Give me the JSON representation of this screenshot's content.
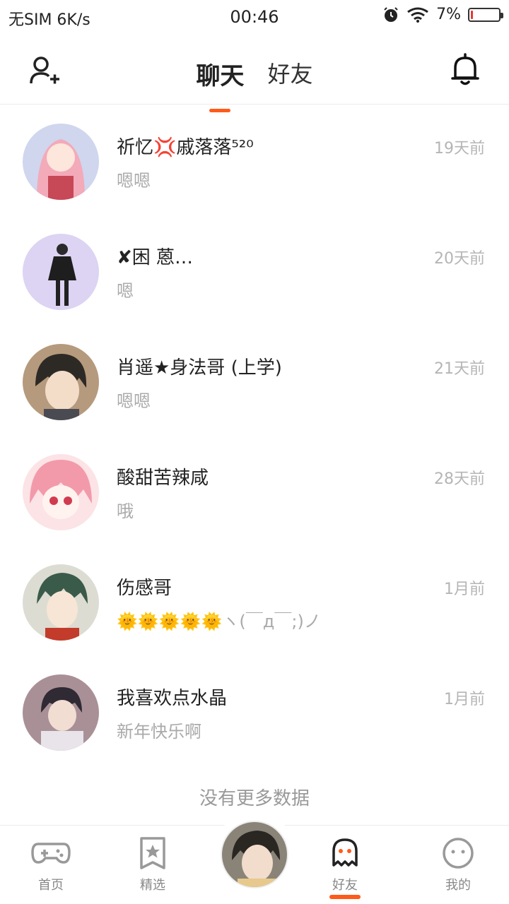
{
  "status_bar": {
    "left": "无SIM 6K/s",
    "time": "00:46",
    "battery": "7%",
    "battery_level": 0.07,
    "icons": [
      "alarm-icon",
      "wifi-icon",
      "battery-icon"
    ]
  },
  "header": {
    "tabs": [
      {
        "label": "聊天",
        "active": true
      },
      {
        "label": "好友",
        "active": false
      }
    ],
    "left_icon": "add-user-icon",
    "right_icon": "bell-icon",
    "accent": "#ff5a1a"
  },
  "chats": [
    {
      "name": "祈忆💢戚落落⁵²⁰",
      "message": "嗯嗯",
      "time": "19天前",
      "avatar_color": "#f4b7c4"
    },
    {
      "name": "✘困  蒽…",
      "message": "嗯",
      "time": "20天前",
      "avatar_color": "#d9cdee"
    },
    {
      "name": "肖遥★身法哥  (上学)",
      "message": "嗯嗯",
      "time": "21天前",
      "avatar_color": "#8a7a66"
    },
    {
      "name": "酸甜苦辣咸",
      "message": "哦",
      "time": "28天前",
      "avatar_color": "#f6c7cf"
    },
    {
      "name": "伤感哥",
      "message": "🌞🌞🌞🌞🌞ヽ(￣д￣;)ノ",
      "time": "1月前",
      "avatar_color": "#cfd3c5"
    },
    {
      "name": "我喜欢点水晶",
      "message": "新年快乐啊",
      "time": "1月前",
      "avatar_color": "#9c8a8e"
    }
  ],
  "list_footer": "没有更多数据",
  "bottom_nav": [
    {
      "label": "首页",
      "icon": "gamepad-icon",
      "active": false
    },
    {
      "label": "精选",
      "icon": "star-badge-icon",
      "active": false
    },
    {
      "label": "",
      "icon": "profile-avatar",
      "active": false
    },
    {
      "label": "好友",
      "icon": "ghost-icon",
      "active": true
    },
    {
      "label": "我的",
      "icon": "face-icon",
      "active": false
    }
  ]
}
